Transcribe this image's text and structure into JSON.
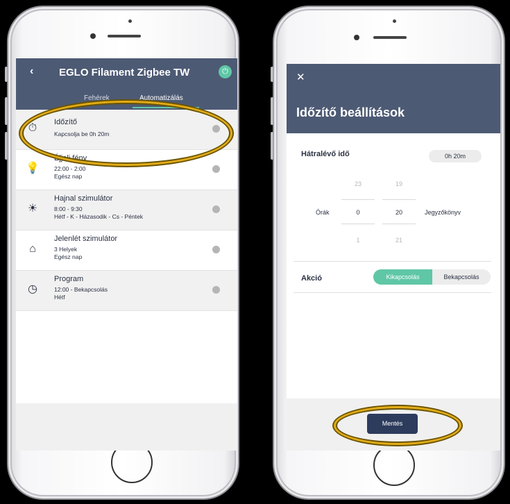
{
  "left_screen": {
    "title": "EGLO Filament Zigbee TW",
    "back_icon": "‹",
    "power_icon": "⏻",
    "tabs": [
      "Fehérek",
      "Automatizálás"
    ],
    "items": [
      {
        "icon": "timer-icon",
        "glyph": "⏱",
        "title": "Időzítő",
        "sub1": "Kapcsolja be 0h 20m",
        "sub2": ""
      },
      {
        "icon": "bulb-icon",
        "glyph": "💡",
        "title": "Éjjeli fény",
        "sub1": "22:00 - 2:00",
        "sub2": "Egész nap"
      },
      {
        "icon": "sunrise-icon",
        "glyph": "☀",
        "title": "Hajnal szimulátor",
        "sub1": "8:00 - 9:30",
        "sub2": "Hétf - K - Házasodik - Cs - Péntek"
      },
      {
        "icon": "home-icon",
        "glyph": "⌂",
        "title": "Jelenlét szimulátor",
        "sub1": "3 Helyek",
        "sub2": "Egész nap"
      },
      {
        "icon": "clock-icon",
        "glyph": "◷",
        "title": "Program",
        "sub1": "12:00 - Bekapcsolás",
        "sub2": "Hétf"
      }
    ]
  },
  "right_screen": {
    "close_icon": "✕",
    "title": "Időzítő beállítások",
    "remaining_label": "Hátralévő idő",
    "remaining_value": "0h 20m",
    "hours_label": "Órák",
    "minutes_label": "Jegyzőkönyv",
    "hours": {
      "prev": "23",
      "current": "0",
      "next": "1"
    },
    "minutes": {
      "prev": "19",
      "current": "20",
      "next": "21"
    },
    "action_label": "Akció",
    "action_off": "Kikapcsolás",
    "action_on": "Bekapcsolás",
    "save_label": "Mentés"
  },
  "colors": {
    "header": "#4d5a74",
    "accent": "#5fc7a6",
    "save": "#2d3b5d",
    "highlight": "#e2ac16"
  }
}
